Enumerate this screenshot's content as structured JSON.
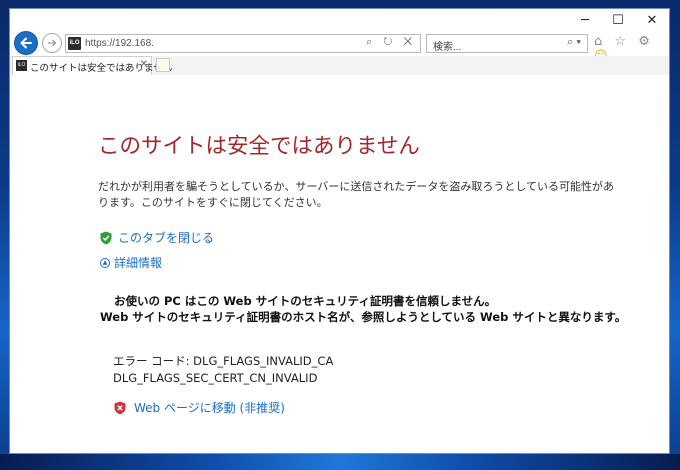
{
  "window": {
    "minimize_glyph": "─",
    "maximize_glyph": "☐",
    "close_glyph": "✕"
  },
  "nav": {
    "back_icon": "←",
    "forward_icon": "⇥",
    "site_icon_text": "iLO",
    "url": "https://192.168.",
    "address_icons": "⌕ ↻ ✕",
    "search_placeholder": "検索...",
    "search_icon": "⌕ ▾",
    "toolbar_icons": [
      "⌂",
      "☆",
      "⚙"
    ],
    "smiley": "☺"
  },
  "tabs": [
    {
      "title": "このサイトは安全ではありません",
      "icon_text": "iLO",
      "close": "✕"
    }
  ],
  "page": {
    "heading": "このサイトは安全ではありません",
    "description": "だれかが利用者を騙そうとしているか、サーバーに送信されたデータを盗み取ろうとしている可能性があります。このサイトをすぐに閉じてください。",
    "close_tab_link": "このタブを閉じる",
    "details_link": "詳細情報",
    "warning_line1": "お使いの PC はこの Web サイトのセキュリティ証明書を信頼しません。",
    "warning_line2": "Web サイトのセキュリティ証明書のホスト名が、参照しようとしている Web サイトと異なります。",
    "error_code_label": "エラー コード: DLG_FLAGS_INVALID_CA",
    "error_code_2": "DLG_FLAGS_SEC_CERT_CN_INVALID",
    "goto_link": "Web ページに移動 (非推奨)"
  },
  "colors": {
    "heading": "#a3272b",
    "link": "#1a6ec8",
    "back_button": "#1a6ec8"
  }
}
